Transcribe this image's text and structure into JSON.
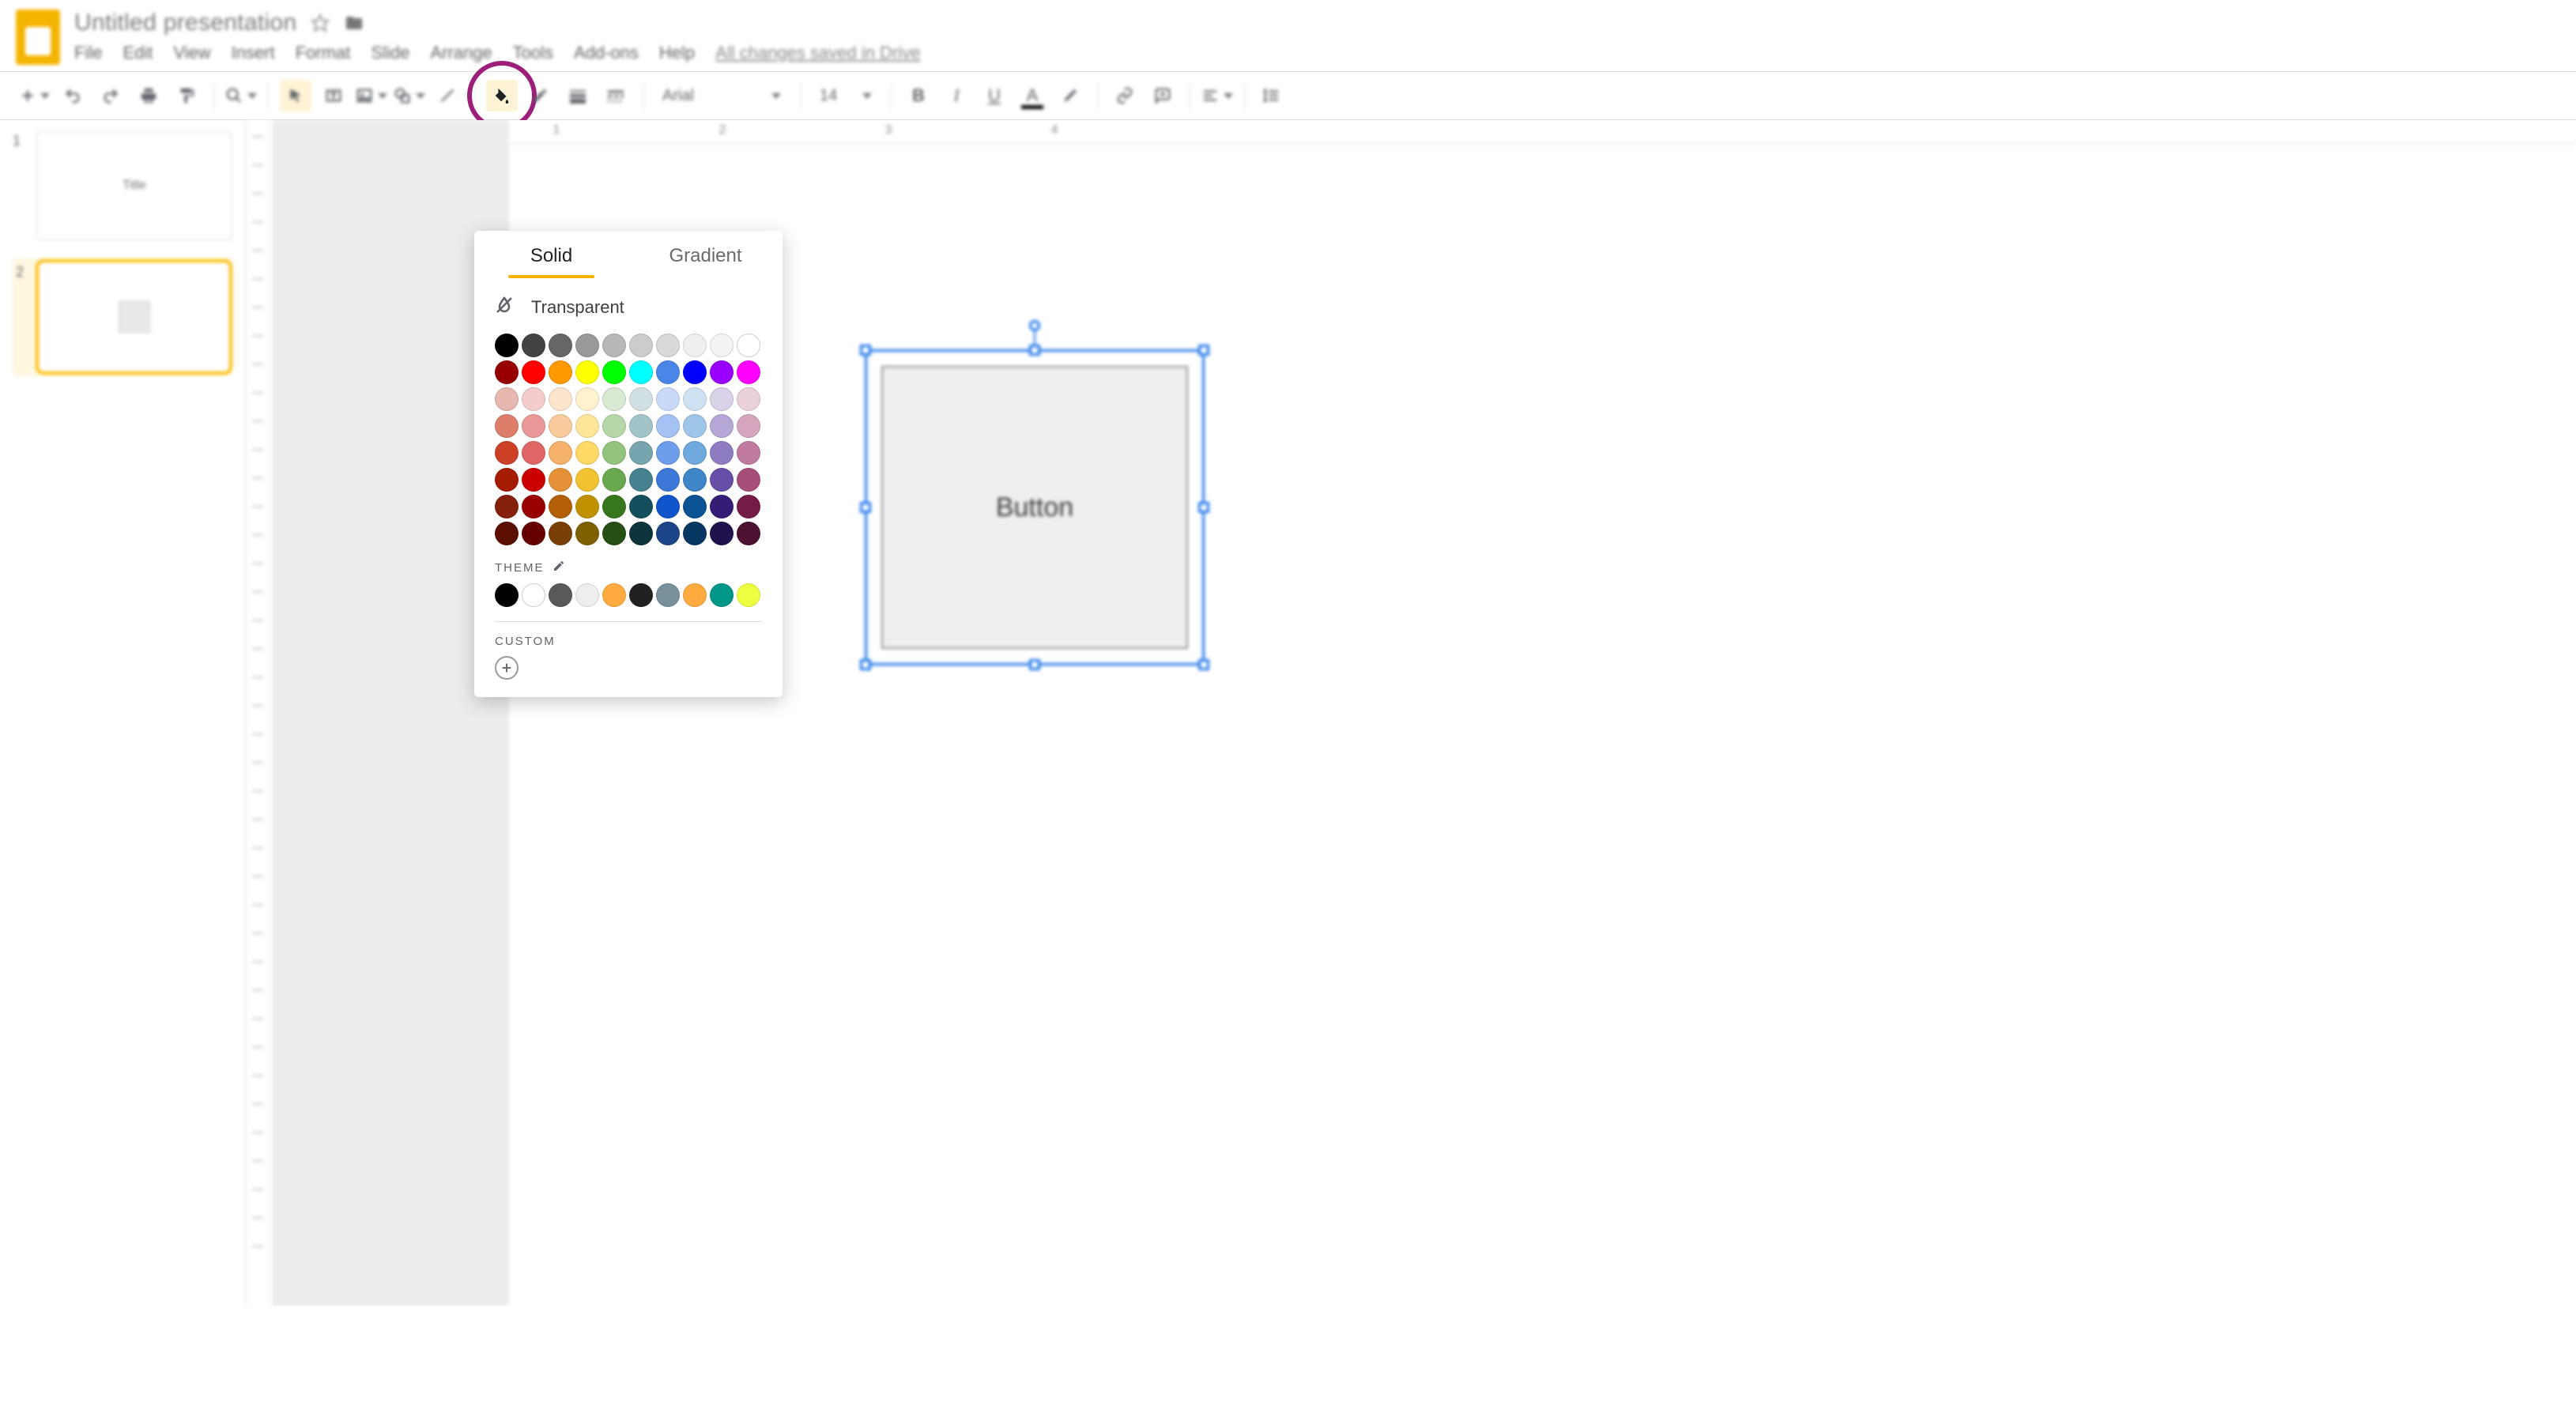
{
  "header": {
    "doc_title": "Untitled presentation",
    "drive_status": "All changes saved in Drive"
  },
  "menu": {
    "items": [
      "File",
      "Edit",
      "View",
      "Insert",
      "Format",
      "Slide",
      "Arrange",
      "Tools",
      "Add-ons",
      "Help"
    ]
  },
  "toolbar": {
    "font_name": "Arial",
    "font_size": "14",
    "icons": {
      "new_slide": "plus-dropdown",
      "undo": "undo",
      "redo": "redo",
      "print": "print",
      "paint_format": "paint-roller",
      "zoom": "zoom-dropdown",
      "select": "cursor",
      "textbox": "textbox",
      "image": "image-dropdown",
      "shape": "shape-dropdown",
      "line": "line",
      "fill_color": "paint-bucket",
      "border_color": "pencil",
      "border_weight": "line-weight",
      "border_dash": "line-dash",
      "bold": "B",
      "italic": "I",
      "underline": "U",
      "text_color": "A",
      "highlight": "highlighter",
      "link": "link",
      "comment": "comment",
      "align": "align-dropdown",
      "line_spacing": "line-spacing"
    }
  },
  "thumbnails": {
    "slides": [
      {
        "number": "1",
        "label": "Title",
        "selected": false,
        "content": "title"
      },
      {
        "number": "2",
        "label": "",
        "selected": true,
        "content": "shape"
      }
    ]
  },
  "ruler": {
    "majors": [
      "1",
      "2",
      "3",
      "4"
    ]
  },
  "canvas": {
    "shape_text": "Button"
  },
  "picker": {
    "tab_solid": "Solid",
    "tab_gradient": "Gradient",
    "transparent_label": "Transparent",
    "theme_label": "THEME",
    "custom_label": "CUSTOM",
    "standard_colors": [
      [
        "#000000",
        "#434343",
        "#666666",
        "#999999",
        "#b7b7b7",
        "#cccccc",
        "#d9d9d9",
        "#efefef",
        "#f3f3f3",
        "#ffffff"
      ],
      [
        "#980000",
        "#ff0000",
        "#ff9900",
        "#ffff00",
        "#00ff00",
        "#00ffff",
        "#4a86e8",
        "#0000ff",
        "#9900ff",
        "#ff00ff"
      ],
      [
        "#e6b8af",
        "#f4cccc",
        "#fce5cd",
        "#fff2cc",
        "#d9ead3",
        "#d0e0e3",
        "#c9daf8",
        "#cfe2f3",
        "#d9d2e9",
        "#ead1dc"
      ],
      [
        "#dd7e6b",
        "#ea9999",
        "#f9cb9c",
        "#ffe599",
        "#b6d7a8",
        "#a2c4c9",
        "#a4c2f4",
        "#9fc5e8",
        "#b4a7d6",
        "#d5a6bd"
      ],
      [
        "#cc4125",
        "#e06666",
        "#f6b26b",
        "#ffd966",
        "#93c47d",
        "#76a5af",
        "#6d9eeb",
        "#6fa8dc",
        "#8e7cc3",
        "#c27ba0"
      ],
      [
        "#a61c00",
        "#cc0000",
        "#e69138",
        "#f1c232",
        "#6aa84f",
        "#45818e",
        "#3c78d8",
        "#3d85c6",
        "#674ea7",
        "#a64d79"
      ],
      [
        "#85200c",
        "#990000",
        "#b45f06",
        "#bf9000",
        "#38761d",
        "#134f5c",
        "#1155cc",
        "#0b5394",
        "#351c75",
        "#741b47"
      ],
      [
        "#5b0f00",
        "#660000",
        "#783f04",
        "#7f6000",
        "#274e13",
        "#0c343d",
        "#1c4587",
        "#073763",
        "#20124d",
        "#4c1130"
      ]
    ],
    "theme_colors": [
      "#000000",
      "#ffffff",
      "#595959",
      "#eeeeee",
      "#ffab40",
      "#212121",
      "#78909c",
      "#ffab40",
      "#009688",
      "#eeff41"
    ]
  }
}
